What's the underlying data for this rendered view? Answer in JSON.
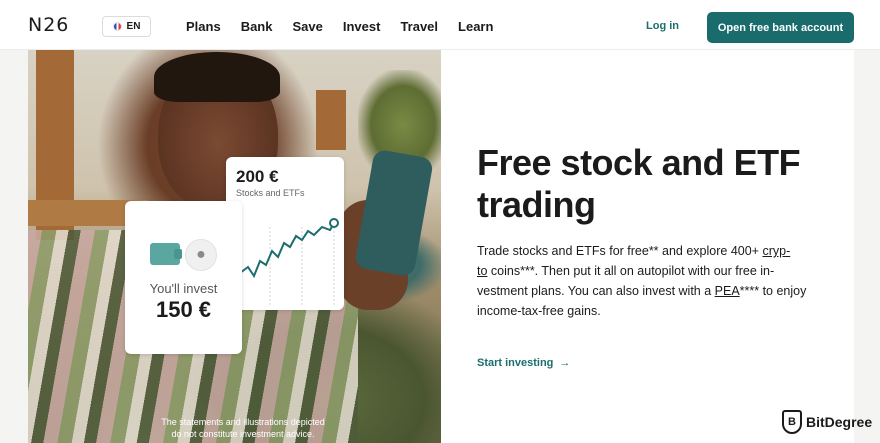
{
  "header": {
    "logo": "N26",
    "lang": "EN",
    "nav": [
      "Plans",
      "Bank",
      "Save",
      "Invest",
      "Travel",
      "Learn"
    ],
    "login": "Log in",
    "cta": "Open free bank account"
  },
  "hero": {
    "chart_card": {
      "amount": "200 €",
      "label": "Stocks and ETFs"
    },
    "invest_card": {
      "label": "You'll invest",
      "amount": "150 €"
    },
    "disclaimer_line1": "The statements and illustrations depicted",
    "disclaimer_line2": "do not constitute investment advice."
  },
  "main": {
    "title_line1": "Free stock and ETF",
    "title_line2": "trading",
    "desc_1": "Trade stocks and ETFs for free** and explore 400+ ",
    "desc_link1": "cryp-",
    "desc_link1b": "to",
    "desc_2": " coins***. Then put it all on autopilot with our free in-vestment plans. You can also invest with a ",
    "desc_link2": "PEA",
    "desc_3": "**** to enjoy income-tax-free gains.",
    "start_link": "Start investing",
    "start_arrow": "→"
  },
  "badge": {
    "text": "BitDegree",
    "icon": "shield-b-icon"
  },
  "colors": {
    "brand": "#196c6b",
    "link": "#1b6e6e"
  }
}
